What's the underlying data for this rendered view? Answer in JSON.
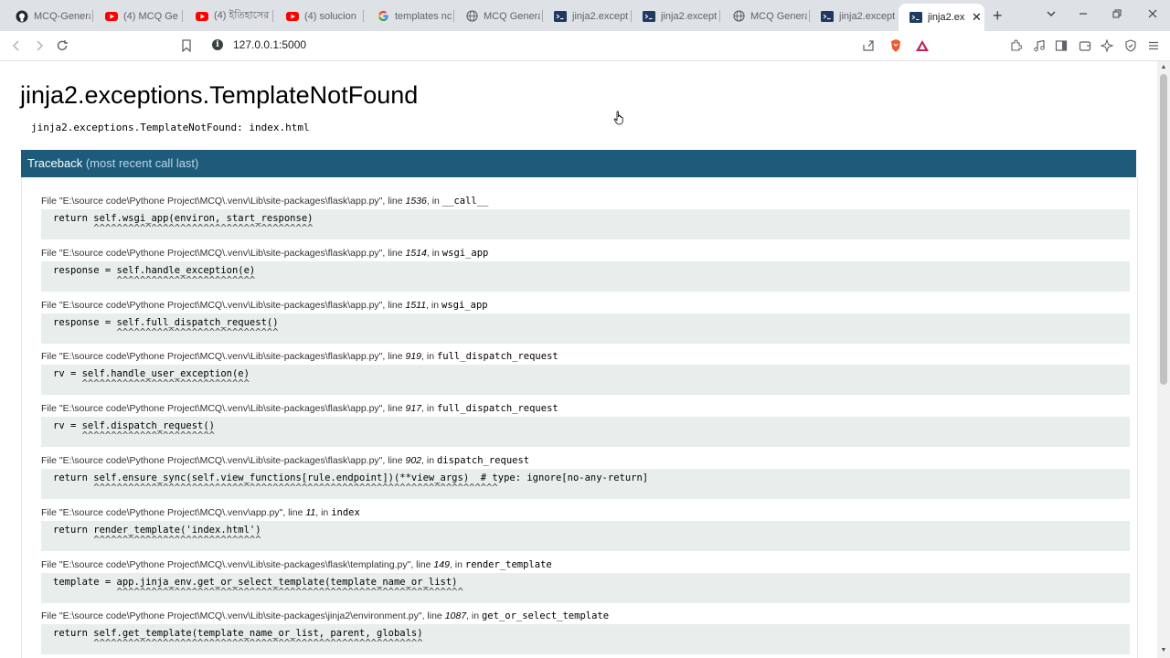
{
  "browser": {
    "tabs": [
      {
        "title": "MCQ-Genera",
        "icon": "github-icon",
        "icon_color": "#24292f"
      },
      {
        "title": "(4) MCQ Ge",
        "icon": "youtube-icon",
        "icon_color": "#ff0000"
      },
      {
        "title": "(4) ইতিহাসের ৭",
        "icon": "youtube-icon",
        "icon_color": "#ff0000"
      },
      {
        "title": "(4) solucion",
        "icon": "youtube-icon",
        "icon_color": "#ff0000"
      },
      {
        "title": "templates nc",
        "icon": "google-icon",
        "icon_color": "#4285f4"
      },
      {
        "title": "MCQ Genera",
        "icon": "globe-icon",
        "icon_color": "#5f6368"
      },
      {
        "title": "jinja2.except",
        "icon": "terminal-icon",
        "icon_color": "#1f3a5f"
      },
      {
        "title": "jinja2.except",
        "icon": "terminal-icon",
        "icon_color": "#1f3a5f"
      },
      {
        "title": "MCQ Genera",
        "icon": "globe-icon",
        "icon_color": "#5f6368"
      },
      {
        "title": "jinja2.except",
        "icon": "terminal-icon",
        "icon_color": "#1f3a5f"
      },
      {
        "title": "jinja2.ex",
        "icon": "terminal-icon",
        "icon_color": "#1f3a5f",
        "active": true
      }
    ],
    "url": "127.0.0.1:5000"
  },
  "error": {
    "title": "jinja2.exceptions.TemplateNotFound",
    "message": "jinja2.exceptions.TemplateNotFound: index.html"
  },
  "traceback": {
    "heading": "Traceback",
    "subheading": "(most recent call last)",
    "frames": [
      {
        "file": "E:\\source code\\Pythone Project\\MCQ\\.venv\\Lib\\site-packages\\flask\\app.py",
        "line": "1536",
        "func": "__call__",
        "code": "return self.wsgi_app(environ, start_response)",
        "carets": "       ^^^^^^^^^^^^^^^^^^^^^^^^^^^^^^^^^^^^^^"
      },
      {
        "file": "E:\\source code\\Pythone Project\\MCQ\\.venv\\Lib\\site-packages\\flask\\app.py",
        "line": "1514",
        "func": "wsgi_app",
        "code": "response = self.handle_exception(e)",
        "carets": "           ^^^^^^^^^^^^^^^^^^^^^^^^"
      },
      {
        "file": "E:\\source code\\Pythone Project\\MCQ\\.venv\\Lib\\site-packages\\flask\\app.py",
        "line": "1511",
        "func": "wsgi_app",
        "code": "response = self.full_dispatch_request()",
        "carets": "           ^^^^^^^^^^^^^^^^^^^^^^^^^^^^"
      },
      {
        "file": "E:\\source code\\Pythone Project\\MCQ\\.venv\\Lib\\site-packages\\flask\\app.py",
        "line": "919",
        "func": "full_dispatch_request",
        "code": "rv = self.handle_user_exception(e)",
        "carets": "     ^^^^^^^^^^^^^^^^^^^^^^^^^^^^^"
      },
      {
        "file": "E:\\source code\\Pythone Project\\MCQ\\.venv\\Lib\\site-packages\\flask\\app.py",
        "line": "917",
        "func": "full_dispatch_request",
        "code": "rv = self.dispatch_request()",
        "carets": "     ^^^^^^^^^^^^^^^^^^^^^^^"
      },
      {
        "file": "E:\\source code\\Pythone Project\\MCQ\\.venv\\Lib\\site-packages\\flask\\app.py",
        "line": "902",
        "func": "dispatch_request",
        "code": "return self.ensure_sync(self.view_functions[rule.endpoint])(**view_args)  # type: ignore[no-any-return]",
        "carets": "       ^^^^^^^^^^^^^^^^^^^^^^^^^^^^^^^^^^^^^^^^^^^^^^^^^^^^^^^^^^^^^^^^^^^^^^"
      },
      {
        "file": "E:\\source code\\Pythone Project\\MCQ\\.venv\\app.py",
        "line": "11",
        "func": "index",
        "code": "return render_template('index.html')",
        "carets": "       ^^^^^^^^^^^^^^^^^^^^^^^^^^^^^"
      },
      {
        "file": "E:\\source code\\Pythone Project\\MCQ\\.venv\\Lib\\site-packages\\flask\\templating.py",
        "line": "149",
        "func": "render_template",
        "code": "template = app.jinja_env.get_or_select_template(template_name_or_list)",
        "carets": "           ^^^^^^^^^^^^^^^^^^^^^^^^^^^^^^^^^^^^^^^^^^^^^^^^^^^^^^^^^^^^"
      },
      {
        "file": "E:\\source code\\Pythone Project\\MCQ\\.venv\\Lib\\site-packages\\jinja2\\environment.py",
        "line": "1087",
        "func": "get_or_select_template",
        "code": "return self.get_template(template_name_or_list, parent, globals)",
        "carets": "       ^^^^^^^^^^^^^^^^^^^^^^^^^^^^^^^^^^^^^^^^^^^^^^^^^^^^^^^^^"
      }
    ]
  },
  "colors": {
    "traceback_header_bg": "#1e5b7a",
    "code_bg": "#e8eeeb"
  }
}
